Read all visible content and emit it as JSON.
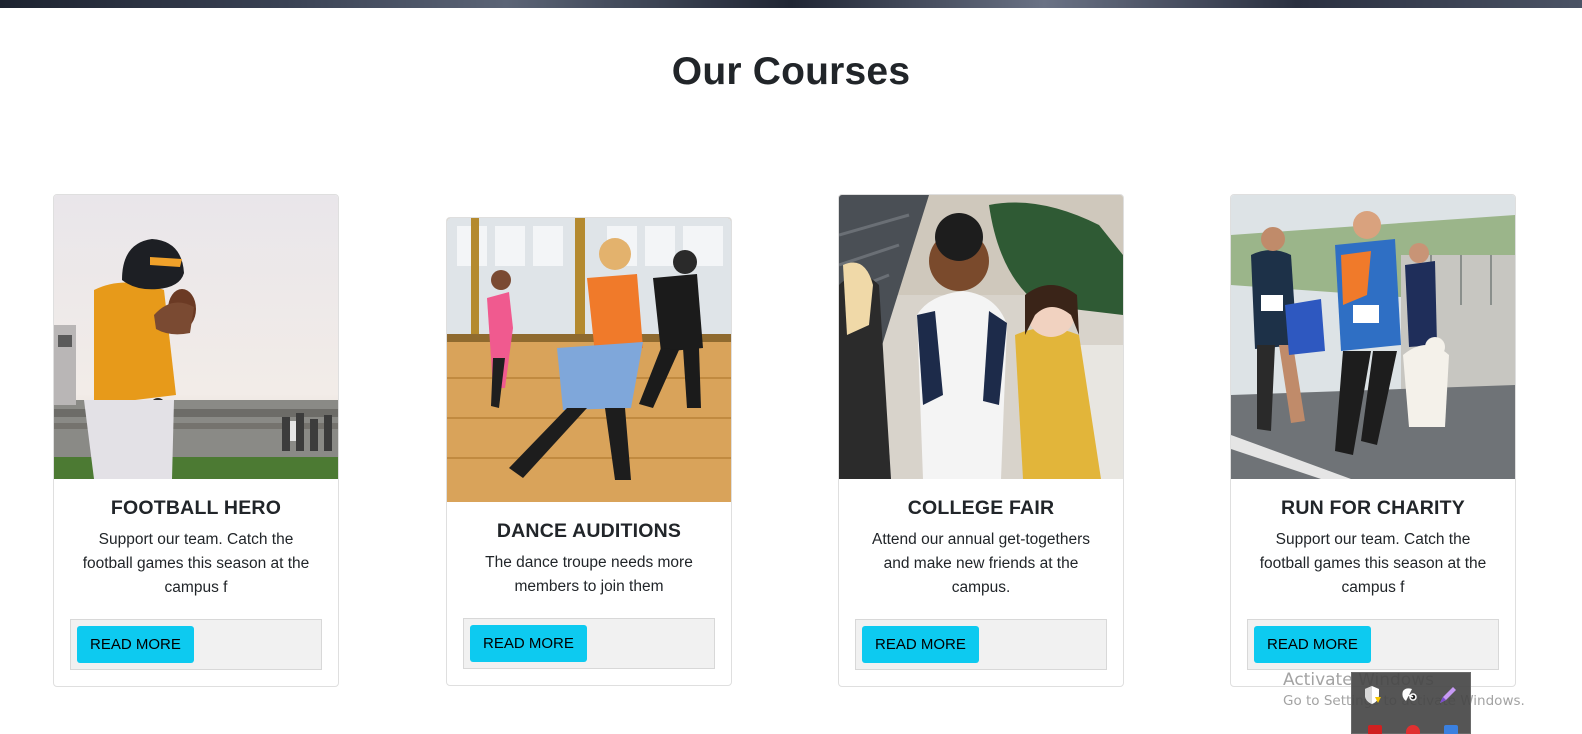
{
  "page": {
    "section_title": "Our Courses"
  },
  "courses": [
    {
      "title": "FOOTBALL HERO",
      "description": "Support our team. Catch the football games this season at the campus f",
      "button_label": "READ MORE"
    },
    {
      "title": "DANCE AUDITIONS",
      "description": "The dance troupe needs more members to join them",
      "button_label": "READ MORE"
    },
    {
      "title": "COLLEGE FAIR",
      "description": "Attend our annual get-togethers and make new friends at the campus.",
      "button_label": "READ MORE"
    },
    {
      "title": "RUN FOR CHARITY",
      "description": "Support our team. Catch the football games this season at the campus f",
      "button_label": "READ MORE"
    }
  ],
  "os_overlay": {
    "activate_title": "Activate Windows",
    "activate_subtitle": "Go to Settings to activate Windows.",
    "tray_icons": [
      "shield-warning-icon",
      "satellite-dish-icon",
      "pen-icon"
    ]
  },
  "colors": {
    "button_bg": "#0dcaf0",
    "footer_bg": "#f1f1f1",
    "card_border": "#dfdfdf",
    "title_text": "#212529"
  }
}
